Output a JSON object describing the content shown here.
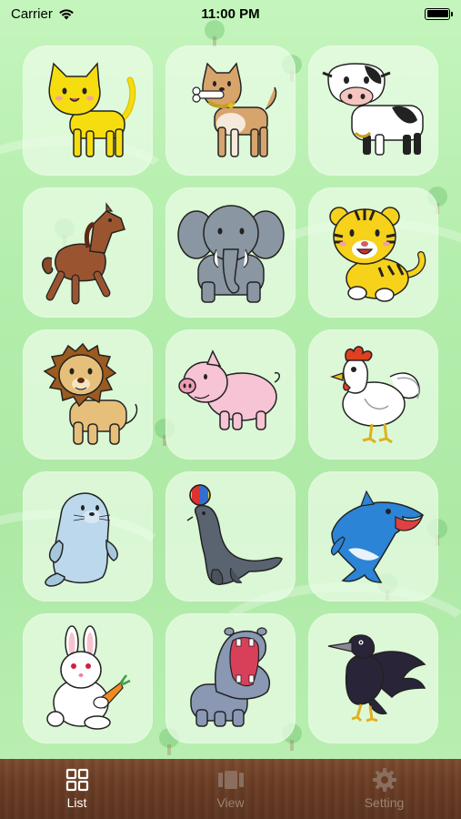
{
  "status_bar": {
    "carrier": "Carrier",
    "time": "11:00 PM"
  },
  "animals": [
    {
      "name": "cat-icon"
    },
    {
      "name": "dog-icon"
    },
    {
      "name": "cow-icon"
    },
    {
      "name": "horse-icon"
    },
    {
      "name": "elephant-icon"
    },
    {
      "name": "tiger-icon"
    },
    {
      "name": "lion-icon"
    },
    {
      "name": "pig-icon"
    },
    {
      "name": "rooster-icon"
    },
    {
      "name": "seal-icon"
    },
    {
      "name": "sea-lion-icon"
    },
    {
      "name": "dolphin-icon"
    },
    {
      "name": "rabbit-icon"
    },
    {
      "name": "hippo-icon"
    },
    {
      "name": "crow-icon"
    }
  ],
  "tabbar": {
    "tabs": [
      {
        "label": "List",
        "icon": "grid-icon",
        "active": true
      },
      {
        "label": "View",
        "icon": "film-icon",
        "active": false
      },
      {
        "label": "Setting",
        "icon": "gear-icon",
        "active": false
      }
    ]
  },
  "colors": {
    "background": "#b9f0b2",
    "tile": "#ecfce8",
    "tabbar": "#6a3d24",
    "tab_active": "#ffffff",
    "tab_inactive": "#9b8374"
  }
}
